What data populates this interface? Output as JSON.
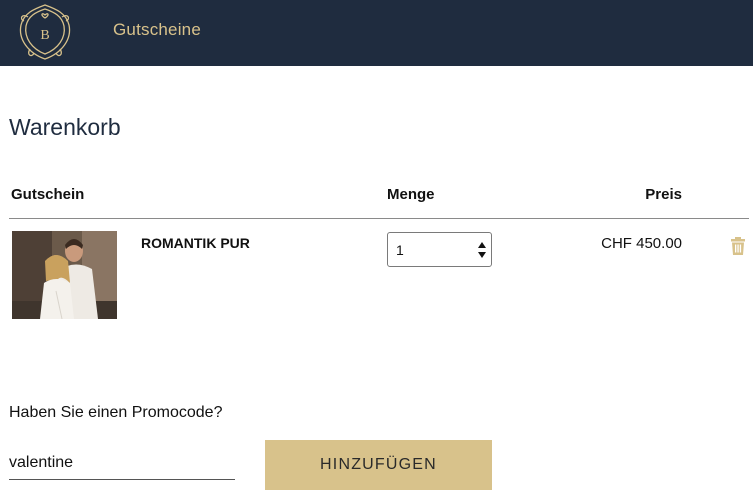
{
  "header": {
    "logo_letter": "B",
    "nav_link": "Gutscheine",
    "bg_color": "#1f2c3f",
    "accent_color": "#d8c28b"
  },
  "page": {
    "title": "Warenkorb"
  },
  "cart": {
    "columns": {
      "voucher": "Gutschein",
      "quantity": "Menge",
      "price": "Preis"
    },
    "items": [
      {
        "name": "ROMANTIK PUR",
        "quantity": "1",
        "price": "CHF 450.00",
        "image_icon": "couple-bathrobes-photo",
        "remove_icon": "trash-icon"
      }
    ]
  },
  "promo": {
    "label": "Haben Sie einen Promocode?",
    "value": "valentine",
    "button_label": "HINZUFÜGEN"
  }
}
